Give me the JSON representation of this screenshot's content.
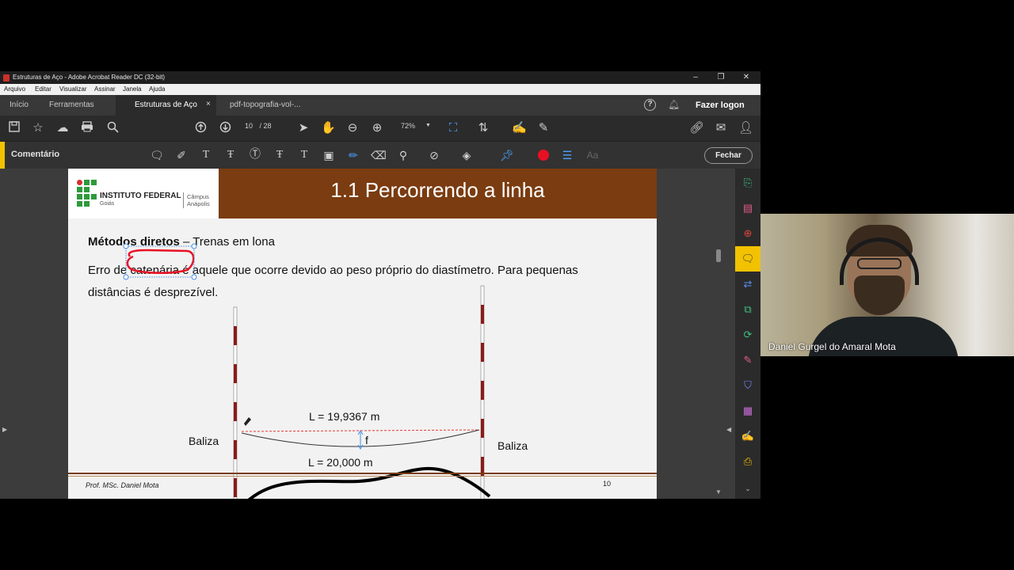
{
  "window": {
    "title": "Estruturas de Aço - Adobe Acrobat Reader DC (32-bit)",
    "minimize": "–",
    "restore": "❐",
    "close": "✕"
  },
  "menu": [
    "Arquivo",
    "Editar",
    "Visualizar",
    "Assinar",
    "Janela",
    "Ajuda"
  ],
  "tabs": {
    "inicio": "Início",
    "ferramentas": "Ferramentas",
    "doc1": "Estruturas de Aço",
    "doc1_close": "×",
    "doc2": "pdf-topografia-vol-...",
    "help": "?",
    "logon": "Fazer logon"
  },
  "toolbar": {
    "page_current": "10",
    "page_total": "/ 28",
    "zoom": "72%"
  },
  "comment_bar": {
    "label": "Comentário",
    "close_label": "Fechar",
    "font_label": "Aa",
    "accent_color": "#f2c200",
    "record_color": "#e81123"
  },
  "slide": {
    "institution": "INSTITUTO FEDERAL",
    "state": "Goiás",
    "campus_line1": "Câmpus",
    "campus_line2": "Anápolis",
    "title": "1.1 Percorrendo a linha",
    "heading_bold": "Métodos diretos",
    "heading_rest": " – Trenas em lona",
    "para_line1_a": "Erro de ",
    "para_line1_highlight": "catenária",
    "para_line1_b": " é aquele que ocorre devido ao peso próprio do diastímetro. Para pequenas",
    "para_line2": "distâncias é desprezível.",
    "baliza_left": "Baliza",
    "baliza_right": "Baliza",
    "measure_top": "L = 19,9367 m",
    "sag_label": "f",
    "measure_bottom": "L = 20,000 m",
    "author": "Prof. MSc. Daniel Mota",
    "page_number": "10",
    "header_color": "#7a3c10"
  },
  "webcam": {
    "participant": "Daniel Gurgel do Amaral Mota"
  }
}
